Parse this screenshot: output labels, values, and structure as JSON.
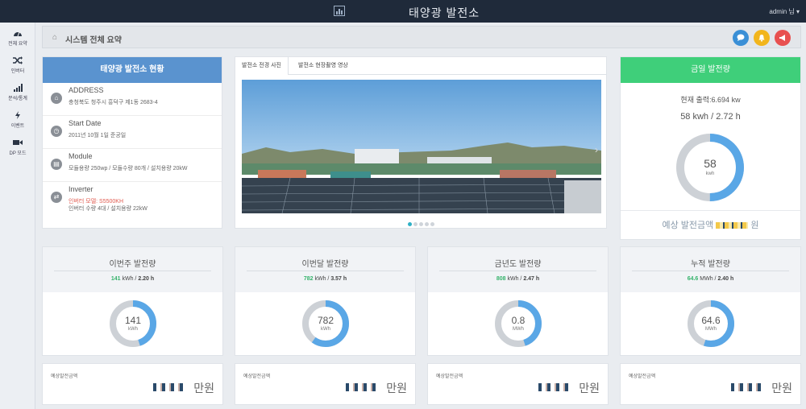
{
  "topbar": {
    "title": "태양광 발전소",
    "user": "admin 님 ▾"
  },
  "sidebar": {
    "items": [
      {
        "label": "전체 요약",
        "icon": "dashboard-icon"
      },
      {
        "label": "인버터",
        "icon": "shuffle-icon"
      },
      {
        "label": "분석/통계",
        "icon": "bar-chart-icon"
      },
      {
        "label": "이벤트",
        "icon": "bolt-icon"
      },
      {
        "label": "DP 모드",
        "icon": "video-icon"
      }
    ]
  },
  "header": {
    "title": "시스템 전체 요약",
    "buttons": [
      {
        "icon": "chat-icon",
        "color": "#3a8fd6"
      },
      {
        "icon": "bell-icon",
        "color": "#f2b51c"
      },
      {
        "icon": "megaphone-icon",
        "color": "#e85050"
      }
    ]
  },
  "plant": {
    "title": "태양광 발전소 현황",
    "address_label": "ADDRESS",
    "address": "충청북도 청주시 흥덕구 제1동 2683-4",
    "start_label": "Start Date",
    "start": "2011년 10월 1일 준공일",
    "module_label": "Module",
    "module": "모듈용량 250wp / 모듈수량 80개 / 설치용량 20kW",
    "inverter_label": "Inverter",
    "inverter_red": "인버터 모델: S5500KH",
    "inverter": "인버터 수량 4대 / 설치용량 22kW"
  },
  "media": {
    "tabs": [
      "발전소 전경 사진",
      "발전소 현장촬영 영상"
    ],
    "slides": 5,
    "active_slide": 0
  },
  "today": {
    "title": "금일 발전량",
    "current_output": "현재 출력:6.694 kw",
    "summary": "58 kwh / 2.72 h",
    "gauge_value": "58",
    "gauge_unit": "kwh",
    "gauge_fraction": 0.5,
    "estimate_label": "예상 발전금액",
    "estimate_unit": "원"
  },
  "cards": [
    {
      "title": "이번주 발전량",
      "value": "141",
      "unit": "kWh",
      "hours": "2.20 h",
      "gauge_value": "141",
      "gauge_unit": "kWh",
      "fraction": 0.45,
      "est_label": "예상발전금액",
      "est_unit": "만원"
    },
    {
      "title": "이번달 발전량",
      "value": "782",
      "unit": "kWh",
      "hours": "3.57 h",
      "gauge_value": "782",
      "gauge_unit": "kWh",
      "fraction": 0.6,
      "est_label": "예상발전금액",
      "est_unit": "만원"
    },
    {
      "title": "금년도 발전량",
      "value": "808",
      "unit": "kWh",
      "hours": "2.47 h",
      "gauge_value": "0.8",
      "gauge_unit": "MWh",
      "fraction": 0.45,
      "est_label": "예상발전금액",
      "est_unit": "만원"
    },
    {
      "title": "누적 발전량",
      "value": "64.6",
      "unit": "MWh",
      "hours": "2.40 h",
      "gauge_value": "64.6",
      "gauge_unit": "MWh",
      "fraction": 0.55,
      "est_label": "예상발전금액",
      "est_unit": "만원"
    }
  ],
  "colors": {
    "blue": "#5aa7e6",
    "grey_ring": "#cdd1d6",
    "green": "#34b26a"
  }
}
